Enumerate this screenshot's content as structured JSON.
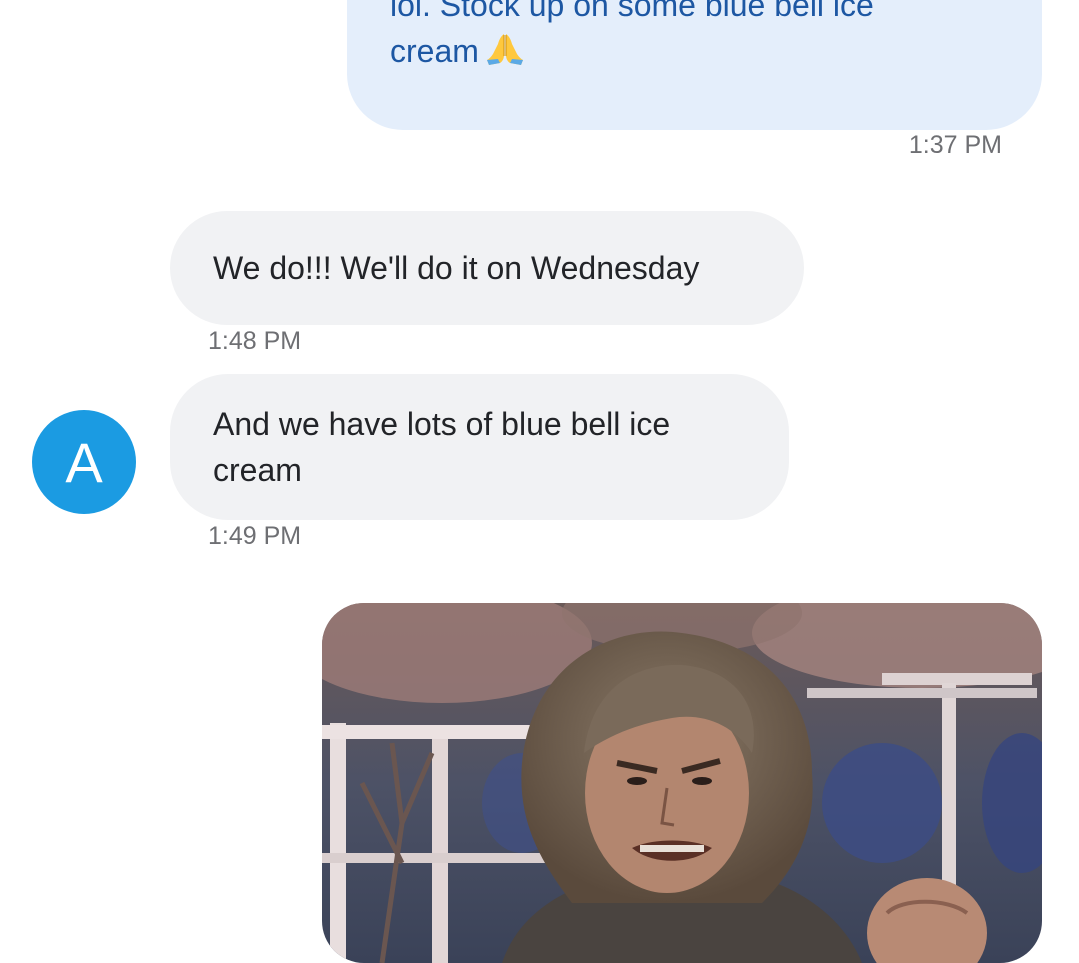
{
  "messages": {
    "outgoing_1": {
      "line1": "lol. Stock up on some blue bell ice",
      "line2": "cream",
      "emoji": "folded-hands-emoji",
      "time": "1:37 PM"
    },
    "incoming_1": {
      "text": "We do!!! We'll do it on Wednesday",
      "time": "1:48 PM"
    },
    "incoming_2": {
      "line1": "And we have lots of blue bell ice",
      "line2": "cream",
      "time": "1:49 PM"
    },
    "outgoing_gif": {
      "description_icon": "gif-image"
    }
  },
  "contact": {
    "avatar_initial": "A",
    "avatar_color": "#1b9be2"
  },
  "colors": {
    "outgoing_bubble": "#e4eefb",
    "outgoing_text": "#1d57a3",
    "incoming_bubble": "#f1f2f4",
    "incoming_text": "#222428",
    "timestamp": "#6e6f73"
  }
}
